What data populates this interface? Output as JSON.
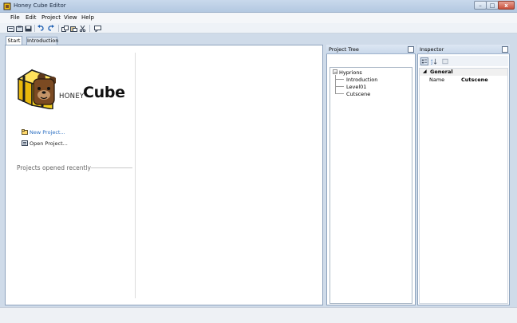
{
  "window": {
    "title": "Honey Cube Editor",
    "controls": {
      "minimize": "–",
      "maximize": "□",
      "close": "x"
    }
  },
  "menu": [
    "File",
    "Edit",
    "Project",
    "View",
    "Help"
  ],
  "toolbar": {
    "icons": [
      "new-file-icon",
      "open-all-icon",
      "save-icon",
      "undo-icon",
      "redo-icon",
      "copy-icon",
      "paste-icon",
      "cut-icon",
      "comment-icon"
    ]
  },
  "tabs": [
    {
      "label": "Start",
      "active": true
    },
    {
      "label": "Introduction",
      "active": false
    }
  ],
  "start_page": {
    "brand_honey": "HONEY",
    "brand_cube": "Cube",
    "new_project": "New Project...",
    "open_project": "Open Project...",
    "recent_label": "Projects opened recently"
  },
  "project_tree": {
    "title": "Project Tree",
    "root": "Hyprions",
    "toggle": "−",
    "children": [
      "Introduction",
      "Level01",
      "Cutscene"
    ]
  },
  "inspector": {
    "title": "Inspector",
    "section_toggle": "◢",
    "section": "General",
    "properties": [
      {
        "name": "Name",
        "value": "Cutscene"
      }
    ]
  },
  "colors": {
    "accent": "#2a6ec2",
    "panel_border": "#8ea3bd",
    "background": "#cfdbe9"
  }
}
